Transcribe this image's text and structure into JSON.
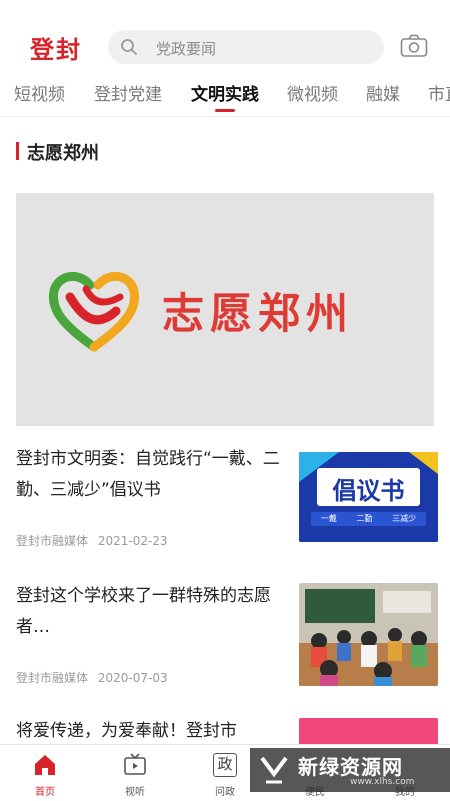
{
  "header": {
    "logo": "登封",
    "search_placeholder": "党政要闻"
  },
  "tabs": [
    "短视频",
    "登封党建",
    "文明实践",
    "微视频",
    "融媒",
    "市直"
  ],
  "active_tab": "文明实践",
  "section": {
    "title": "志愿郑州"
  },
  "banner": {
    "text": "志愿郑州",
    "caption": "志愿郑州"
  },
  "articles": [
    {
      "title": "登封市文明委：自觉践行“一戴、二勤、三减少”倡议书",
      "source": "登封市融媒体",
      "date": "2021-02-23",
      "thumb_title": "倡议书",
      "thumb_sub": [
        "一戴",
        "二勤",
        "三减少"
      ]
    },
    {
      "title": "登封这个学校来了一群特殊的志愿者…",
      "source": "登封市融媒体",
      "date": "2020-07-03"
    },
    {
      "title": "将爱传递，为爱奉献！登封市"
    }
  ],
  "bottom_nav": [
    {
      "label": "首页",
      "icon": "home-icon",
      "active": true
    },
    {
      "label": "视听",
      "icon": "tv-icon",
      "active": false
    },
    {
      "label": "问政",
      "icon": "politics-icon",
      "active": false,
      "glyph": "政"
    },
    {
      "label": "便民",
      "icon": "convenience-icon",
      "active": false
    },
    {
      "label": "我的",
      "icon": "profile-icon",
      "active": false
    }
  ],
  "watermark": {
    "text": "新绿资源网",
    "sub": "www.xlhs.com"
  },
  "colors": {
    "accent": "#d8232a",
    "muted": "#9a9a9a"
  }
}
